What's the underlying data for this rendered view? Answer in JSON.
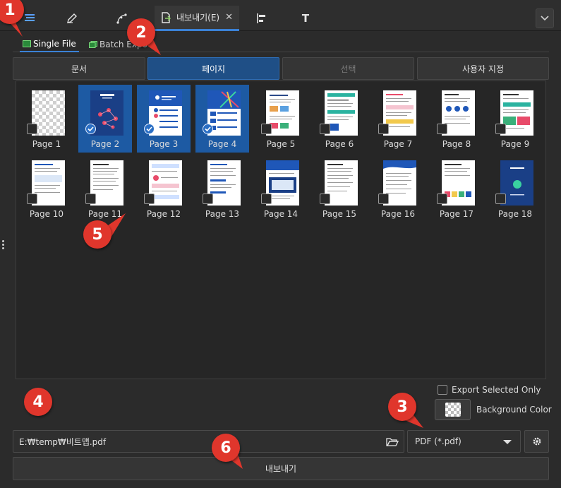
{
  "toolbar": {
    "tabs": [
      {
        "icon": "layers-icon"
      },
      {
        "icon": "edit-pen-icon"
      },
      {
        "icon": "node-curve-icon"
      },
      {
        "icon": "export-document-icon",
        "label": "내보내기(E)",
        "close": "✕"
      },
      {
        "icon": "align-left-icon"
      },
      {
        "icon": "text-tool-icon",
        "label": "T"
      }
    ],
    "collapse_icon": "chevron-down-icon"
  },
  "subtabs": {
    "single": "Single File",
    "batch": "Batch Expo"
  },
  "modes": [
    "문서",
    "페이지",
    "선택",
    "사용자 지정"
  ],
  "pages": [
    {
      "label": "Page 1",
      "selected": false
    },
    {
      "label": "Page 2",
      "selected": true
    },
    {
      "label": "Page 3",
      "selected": true
    },
    {
      "label": "Page 4",
      "selected": true
    },
    {
      "label": "Page 5",
      "selected": false
    },
    {
      "label": "Page 6",
      "selected": false
    },
    {
      "label": "Page 7",
      "selected": false
    },
    {
      "label": "Page 8",
      "selected": false
    },
    {
      "label": "Page 9",
      "selected": false
    },
    {
      "label": "Page 10",
      "selected": false
    },
    {
      "label": "Page 11",
      "selected": false
    },
    {
      "label": "Page 12",
      "selected": false
    },
    {
      "label": "Page 13",
      "selected": false
    },
    {
      "label": "Page 14",
      "selected": false
    },
    {
      "label": "Page 15",
      "selected": false
    },
    {
      "label": "Page 16",
      "selected": false
    },
    {
      "label": "Page 17",
      "selected": false
    },
    {
      "label": "Page 18",
      "selected": false
    }
  ],
  "options": {
    "export_selected_only": "Export Selected Only",
    "background_color": "Background Color"
  },
  "output": {
    "path": "E:₩temp₩비트맵.pdf",
    "format": "PDF (*.pdf)",
    "export_button": "내보내기"
  },
  "markers": [
    "1",
    "2",
    "3",
    "4",
    "5",
    "6"
  ],
  "colors": {
    "accent": "#3b82d6",
    "selected": "#1d5aa3",
    "marker": "#e0362c"
  }
}
